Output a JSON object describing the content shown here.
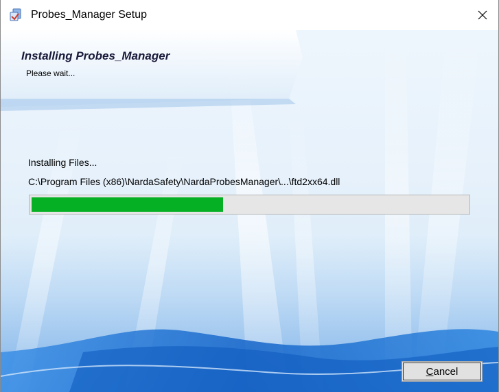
{
  "window": {
    "title": "Probes_Manager Setup"
  },
  "icons": {
    "app": "installer-icon",
    "close": "close-icon"
  },
  "header": {
    "title": "Installing Probes_Manager",
    "subtitle": "Please wait..."
  },
  "install": {
    "status": "Installing Files...",
    "current_file": "C:\\Program Files (x86)\\NardaSafety\\NardaProbesManager\\...\\ftd2xx64.dll",
    "progress_fraction": 0.44
  },
  "buttons": {
    "cancel_mnemonic": "C",
    "cancel_rest": "ancel"
  },
  "colors": {
    "progress_fill": "#06b025",
    "progress_track": "#e6e6e6",
    "background_accent": "#1e6fd0"
  }
}
